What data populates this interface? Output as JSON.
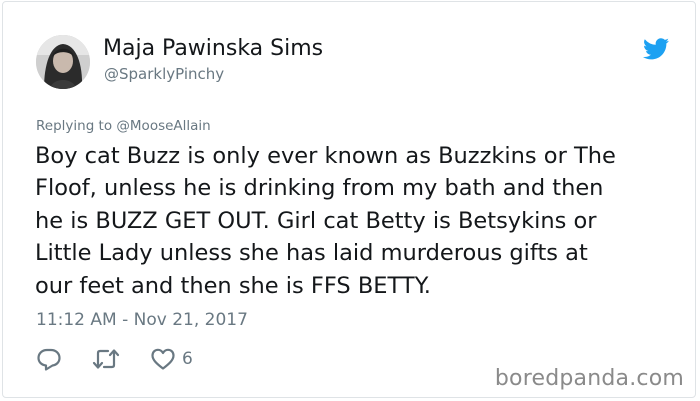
{
  "tweet": {
    "author": {
      "display_name": "Maja Pawinska Sims",
      "handle": "@SparklyPinchy"
    },
    "replying_prefix": "Replying to",
    "replying_to": "@MooseAllain",
    "text_lines": [
      "Boy cat Buzz is only ever known as Buzzkins or The",
      "Floof, unless he is drinking from my bath and then",
      "he is BUZZ GET OUT. Girl cat Betty is Betsykins or",
      "Little Lady unless she has laid murderous gifts at",
      "our feet and then she is FFS BETTY."
    ],
    "timestamp": "11:12 AM - Nov 21, 2017",
    "likes": "6"
  },
  "icons": {
    "brand": "twitter-bird-icon",
    "reply": "reply-icon",
    "retweet": "retweet-icon",
    "like": "heart-icon"
  },
  "colors": {
    "twitter_blue": "#1da1f2",
    "text": "#14171a",
    "muted": "#697882",
    "watermark": "#8a8a8a"
  },
  "watermark": "boredpanda.com"
}
